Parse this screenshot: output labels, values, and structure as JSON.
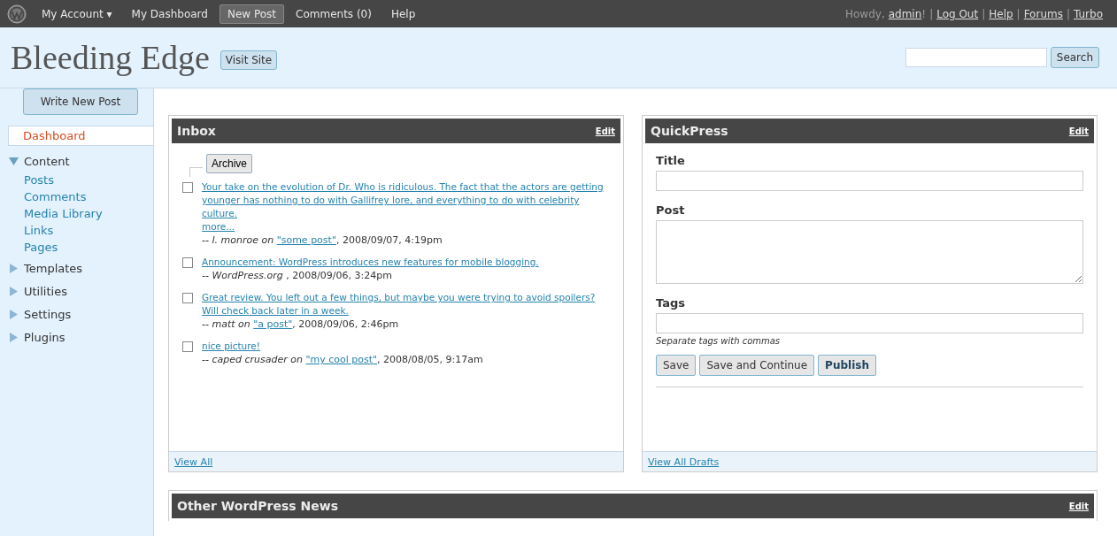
{
  "topbar": {
    "nav": [
      {
        "label": "My Account ▾",
        "selected": false
      },
      {
        "label": "My Dashboard",
        "selected": false
      },
      {
        "label": "New Post",
        "selected": true
      },
      {
        "label": "Comments (0)",
        "selected": false
      },
      {
        "label": "Help",
        "selected": false
      }
    ],
    "greeting": "Howdy,",
    "user": "admin",
    "user_suffix": "!",
    "separator": "|",
    "links": [
      "Log Out",
      "Help",
      "Forums",
      "Turbo"
    ]
  },
  "header": {
    "site_title": "Bleeding Edge",
    "visit_button": "Visit Site",
    "search_button": "Search"
  },
  "sidebar": {
    "write_button": "Write New Post",
    "items": [
      {
        "label": "Dashboard",
        "selected": true
      },
      {
        "label": "Content",
        "expanded": true,
        "children": [
          {
            "label": "Posts"
          },
          {
            "label": "Comments"
          },
          {
            "label": "Media Library"
          },
          {
            "label": "Links"
          },
          {
            "label": "Pages"
          }
        ]
      },
      {
        "label": "Templates",
        "expanded": false
      },
      {
        "label": "Utilities",
        "expanded": false
      },
      {
        "label": "Settings",
        "expanded": false
      },
      {
        "label": "Plugins",
        "expanded": false
      }
    ]
  },
  "inbox": {
    "title": "Inbox",
    "edit": "Edit",
    "archive_button": "Archive",
    "footer_link": "View All",
    "messages": [
      {
        "checked": false,
        "text": "Your take on the evolution of Dr. Who is ridiculous. The fact that the actors are getting younger has nothing to do with Gallifrey lore, and everything to do with celebrity culture.",
        "more": "more...",
        "author": "-- l. monroe on",
        "post": "\"some post\"",
        "date": ", 2008/09/07, 4:19pm"
      },
      {
        "checked": false,
        "text": "Announcement: WordPress introduces new features for mobile blogging.",
        "author": "-- WordPress.org",
        "date": ", 2008/09/06, 3:24pm"
      },
      {
        "checked": false,
        "text": "Great review. You left out a few things, but maybe you were trying to avoid spoilers? Will check back later in a week.",
        "author": "-- matt on",
        "post": "\"a post\"",
        "date": ", 2008/09/06, 2:46pm"
      },
      {
        "checked": false,
        "text": "nice picture!",
        "author": "-- caped crusader on",
        "post": "\"my cool post\"",
        "date": ", 2008/08/05, 9:17am"
      }
    ]
  },
  "quickpress": {
    "title": "QuickPress",
    "edit": "Edit",
    "fields": [
      {
        "label": "Title",
        "kind": "input"
      },
      {
        "label": "Post",
        "kind": "textarea"
      },
      {
        "label": "Tags",
        "kind": "input",
        "hint": "Separate tags with commas"
      }
    ],
    "buttons": [
      {
        "label": "Save",
        "primary": false
      },
      {
        "label": "Save and Continue",
        "primary": false
      },
      {
        "label": "Publish",
        "primary": true
      }
    ],
    "footer_link": "View All Drafts"
  },
  "news": {
    "title": "Other WordPress News",
    "edit": "Edit"
  }
}
